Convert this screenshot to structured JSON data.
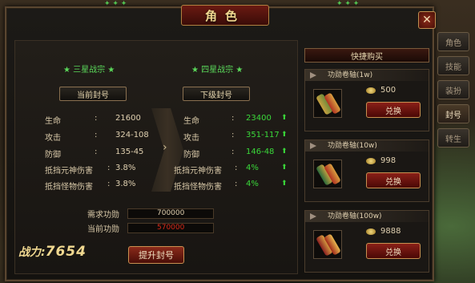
{
  "window": {
    "title": "角色",
    "close_label": "✕"
  },
  "current_rank": {
    "name": "三星战宗",
    "plate_label": "当前封号",
    "stats": [
      {
        "label": "生命",
        "value": "21600"
      },
      {
        "label": "攻击",
        "value": "324-108"
      },
      {
        "label": "防御",
        "value": "135-45"
      },
      {
        "label": "抵挡元神伤害",
        "value": "3.8%"
      },
      {
        "label": "抵挡怪物伤害",
        "value": "3.8%"
      }
    ]
  },
  "next_rank": {
    "name": "四星战宗",
    "plate_label": "下级封号",
    "stats": [
      {
        "label": "生命",
        "value": "23400"
      },
      {
        "label": "攻击",
        "value": "351-117"
      },
      {
        "label": "防御",
        "value": "146-48"
      },
      {
        "label": "抵挡元神伤害",
        "value": "4%"
      },
      {
        "label": "抵挡怪物伤害",
        "value": "4%"
      }
    ]
  },
  "requirements": {
    "required_label": "需求功勋",
    "required_value": "700000",
    "current_label": "当前功勋",
    "current_value": "570000"
  },
  "power": {
    "label": "战力:",
    "value": "7654"
  },
  "promote_button": "提升封号",
  "quick_buy": {
    "title": "快捷购买",
    "items": [
      {
        "name": "功勋卷轴(1w)",
        "price": "500",
        "button": "兑换"
      },
      {
        "name": "功勋卷轴(10w)",
        "price": "998",
        "button": "兑换"
      },
      {
        "name": "功勋卷轴(100w)",
        "price": "9888",
        "button": "兑换"
      }
    ]
  },
  "side_tabs": [
    {
      "label": "角色",
      "active": false
    },
    {
      "label": "技能",
      "active": false
    },
    {
      "label": "装扮",
      "active": false
    },
    {
      "label": "封号",
      "active": true
    },
    {
      "label": "转生",
      "active": false
    }
  ],
  "colors": {
    "green": "#3ad83a",
    "red": "#d82a1a",
    "gold": "#f0d890"
  }
}
